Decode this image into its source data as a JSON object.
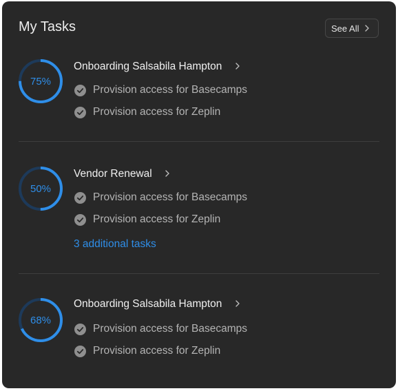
{
  "header": {
    "title": "My Tasks",
    "see_all_label": "See All"
  },
  "colors": {
    "background": "#282828",
    "accent": "#2f8ee8",
    "ring_track": "#1d3a5a",
    "text": "#f0f0f0",
    "muted": "#b4b4b4"
  },
  "icons": {
    "check": "check-circle-icon",
    "chevron": "chevron-right-icon"
  },
  "tasks": [
    {
      "title": "Onboarding Salsabila Hampton",
      "progress": 75,
      "progress_label": "75%",
      "subtasks": [
        "Provision access for Basecamps",
        "Provision access for Zeplin"
      ],
      "additional": ""
    },
    {
      "title": "Vendor Renewal",
      "progress": 50,
      "progress_label": "50%",
      "subtasks": [
        "Provision access for Basecamps",
        "Provision access for Zeplin"
      ],
      "additional": "3 additional tasks"
    },
    {
      "title": "Onboarding Salsabila Hampton",
      "progress": 68,
      "progress_label": "68%",
      "subtasks": [
        "Provision access for Basecamps",
        "Provision access for Zeplin"
      ],
      "additional": ""
    }
  ]
}
